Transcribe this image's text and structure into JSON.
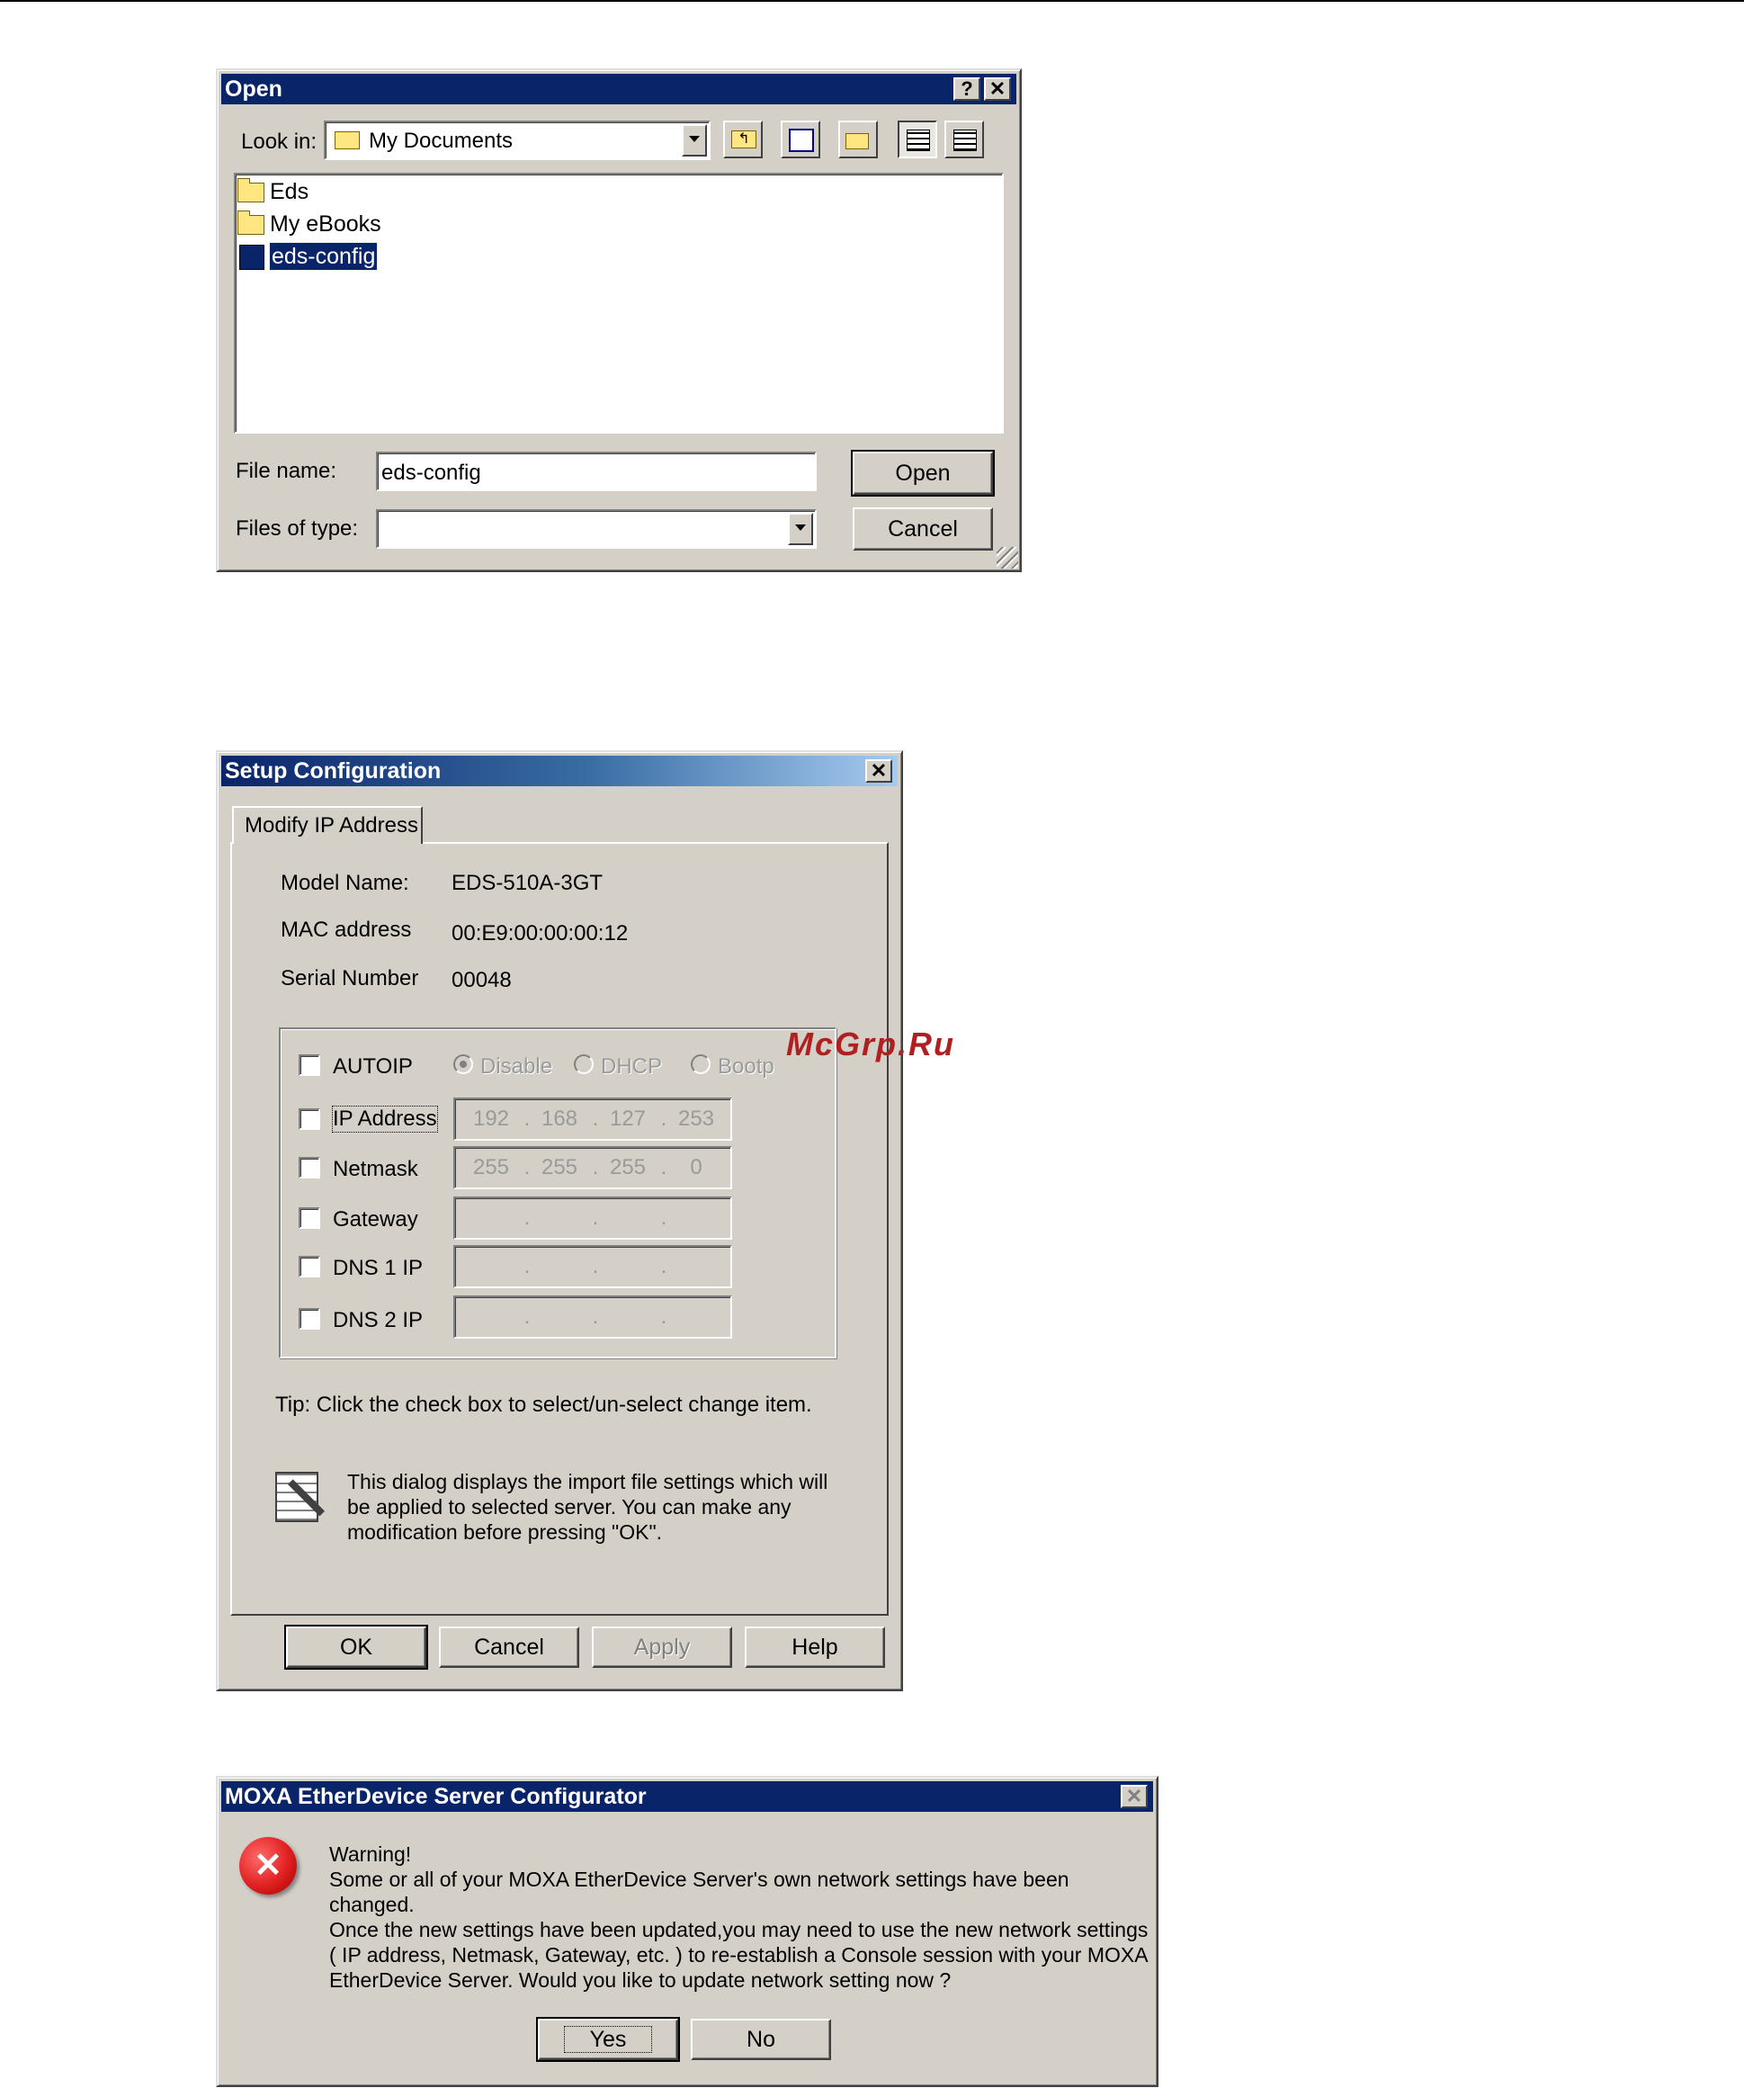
{
  "open_dialog": {
    "title": "Open",
    "help_glyph": "?",
    "close_glyph": "✕",
    "look_in_label": "Look in:",
    "look_in_value": "My Documents",
    "files": [
      {
        "name": "Eds",
        "icon": "folder-icon"
      },
      {
        "name": "My eBooks",
        "icon": "folder-icon"
      },
      {
        "name": "eds-config",
        "icon": "file-icon",
        "selected": true
      }
    ],
    "file_name_label": "File name:",
    "file_name_value": "eds-config",
    "files_of_type_label": "Files of type:",
    "files_of_type_value": "",
    "open_button": "Open",
    "cancel_button": "Cancel"
  },
  "setup_dialog": {
    "title": "Setup Configuration",
    "close_glyph": "✕",
    "tab": "Modify IP Address",
    "model_name_label": "Model Name:",
    "model_name_value": "EDS-510A-3GT",
    "mac_label": "MAC address",
    "mac_value": "00:E9:00:00:00:12",
    "serial_label": "Serial Number",
    "serial_value": "00048",
    "autoip_label": "AUTOIP",
    "radio_options": [
      "Disable",
      "DHCP",
      "Bootp"
    ],
    "rows": [
      {
        "label": "IP Address",
        "octets": [
          "192",
          "168",
          "127",
          "253"
        ]
      },
      {
        "label": "Netmask",
        "octets": [
          "255",
          "255",
          "255",
          "0"
        ]
      },
      {
        "label": "Gateway",
        "octets": [
          "",
          "",
          "",
          ""
        ]
      },
      {
        "label": "DNS 1 IP",
        "octets": [
          "",
          "",
          "",
          ""
        ]
      },
      {
        "label": "DNS 2 IP",
        "octets": [
          "",
          "",
          "",
          ""
        ]
      }
    ],
    "ip_separator": ".",
    "tip": "Tip: Click the check box to select/un-select change item.",
    "info_lines": [
      "This dialog displays the import file settings which will",
      "be applied to selected server. You can make any",
      "modification before pressing \"OK\"."
    ],
    "ok_button": "OK",
    "cancel_button": "Cancel",
    "apply_button": "Apply",
    "help_button": "Help"
  },
  "watermark": "McGrp.Ru",
  "moxa_dialog": {
    "title": "MOXA EtherDevice Server Configurator",
    "close_glyph": "✕",
    "message_lines": [
      "Warning!",
      "Some or all of your MOXA EtherDevice Server's own network settings have been",
      "changed.",
      "Once the new settings have been updated,you may need to use the new network settings",
      "( IP address, Netmask, Gateway,  etc. ) to re-establish a Console session with your MOXA",
      "EtherDevice Server. Would you like to update network setting now ?"
    ],
    "yes_button": "Yes",
    "no_button": "No",
    "error_glyph": "✕"
  },
  "colors": {
    "title_bar": "#0a246a",
    "dialog_face": "#d4d0c8",
    "selection": "#0a246a",
    "error_red": "#e02020"
  }
}
